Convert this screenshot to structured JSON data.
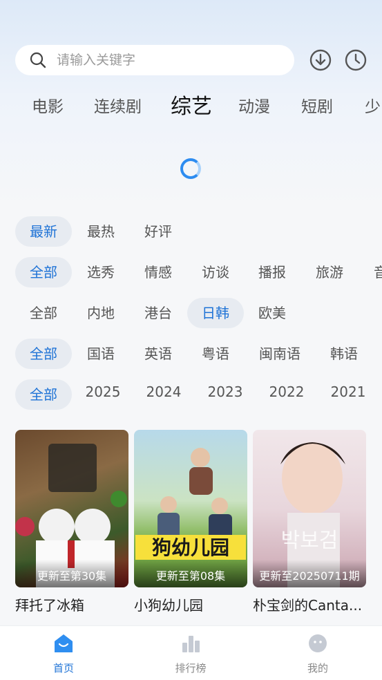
{
  "search": {
    "placeholder": "请输入关键字"
  },
  "header_icons": {
    "download": "download-icon",
    "history": "history-icon"
  },
  "category_tabs": [
    {
      "label": "电影",
      "active": false
    },
    {
      "label": "连续剧",
      "active": false
    },
    {
      "label": "综艺",
      "active": true
    },
    {
      "label": "动漫",
      "active": false
    },
    {
      "label": "短剧",
      "active": false
    },
    {
      "label": "少",
      "active": false
    }
  ],
  "filters": {
    "sort": [
      "最新",
      "最热",
      "好评"
    ],
    "genre": [
      "全部",
      "选秀",
      "情感",
      "访谈",
      "播报",
      "旅游",
      "音"
    ],
    "region": [
      "全部",
      "内地",
      "港台",
      "日韩",
      "欧美"
    ],
    "language": [
      "全部",
      "国语",
      "英语",
      "粤语",
      "闽南语",
      "韩语"
    ],
    "year": [
      "全部",
      "2025",
      "2024",
      "2023",
      "2022",
      "2021"
    ]
  },
  "cards": [
    {
      "title": "拜托了冰箱",
      "update": "更新至第30集"
    },
    {
      "title": "小狗幼儿园",
      "update": "更新至第08集"
    },
    {
      "title": "朴宝剑的Canta...",
      "update": "更新至20250711期"
    }
  ],
  "bottom_nav": [
    {
      "label": "首页",
      "icon": "home-icon",
      "active": true
    },
    {
      "label": "排行榜",
      "icon": "ranking-icon",
      "active": false
    },
    {
      "label": "我的",
      "icon": "profile-icon",
      "active": false
    }
  ],
  "colors": {
    "accent": "#1f73d6",
    "chip_active_bg": "#e7ebf1",
    "spinner": "#2d8cf0"
  }
}
